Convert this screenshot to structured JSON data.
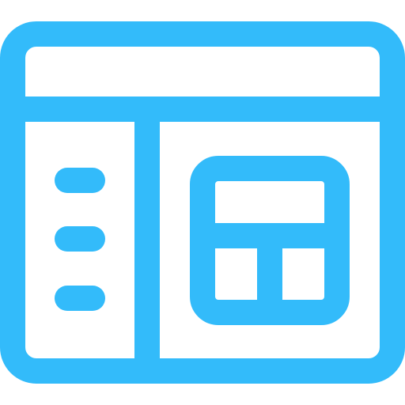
{
  "icon": {
    "name": "dashboard-layout-window-icon",
    "stroke_color": "#33BBFA",
    "background_color": "#FFFFFF",
    "parts": {
      "window_frame": "window-frame",
      "title_bar": "title-bar",
      "sidebar": "sidebar",
      "sidebar_menu_lines": [
        "menu-line",
        "menu-line",
        "menu-line"
      ],
      "widget": "dashboard-widget"
    }
  }
}
